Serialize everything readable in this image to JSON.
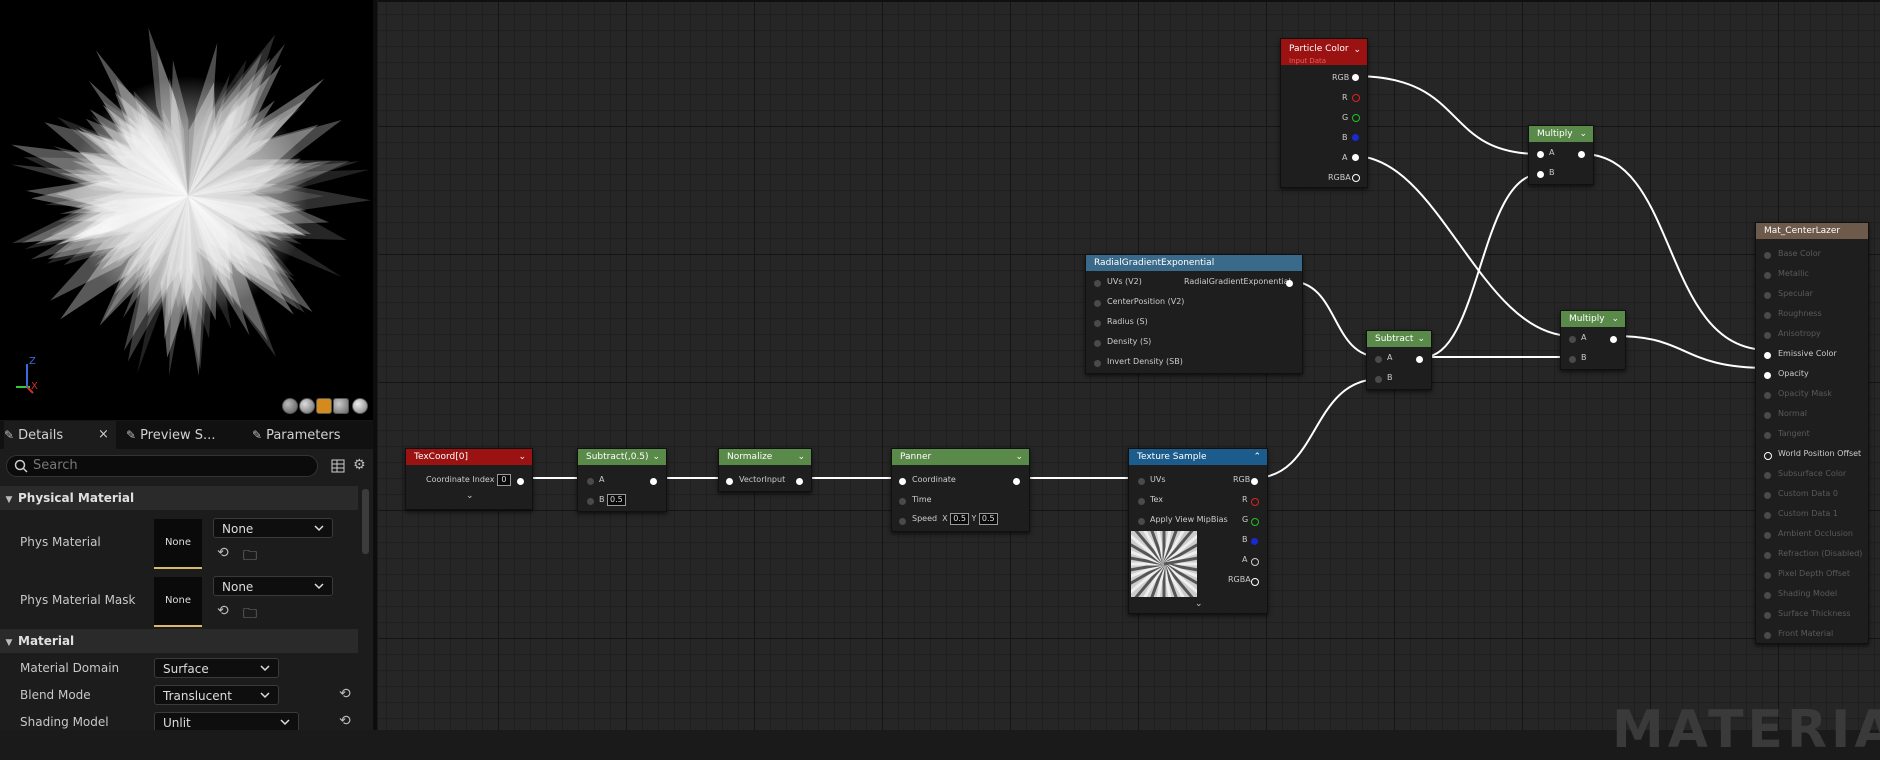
{
  "details_panel": {
    "tabs": [
      {
        "label": "Details",
        "close": "×"
      },
      {
        "label": "Preview S..."
      },
      {
        "label": "Parameters"
      }
    ],
    "search_placeholder": "Search",
    "sections": {
      "physical_material": {
        "title": "Physical Material",
        "phys_material_label": "Phys Material",
        "phys_material_thumb": "None",
        "phys_material_value": "None",
        "phys_material_mask_label": "Phys Material Mask",
        "phys_material_mask_thumb": "None",
        "phys_material_mask_value": "None"
      },
      "material": {
        "title": "Material",
        "material_domain_label": "Material Domain",
        "material_domain_value": "Surface",
        "blend_mode_label": "Blend Mode",
        "blend_mode_value": "Translucent",
        "shading_model_label": "Shading Model",
        "shading_model_value": "Unlit"
      }
    },
    "axis_labels": {
      "z": "Z",
      "x": "X"
    }
  },
  "graph": {
    "watermark": "MATERIAL",
    "nodes": {
      "texcoord": {
        "title": "TexCoord[0]",
        "pins": {
          "coord_index_label": "Coordinate Index",
          "coord_index_value": "0"
        },
        "color": "#9b1212"
      },
      "subtract_const": {
        "title": "Subtract(,0.5)",
        "pins": {
          "a": "A",
          "b": "B",
          "b_value": "0.5"
        },
        "color": "#5a8a4a"
      },
      "normalize": {
        "title": "Normalize",
        "pins": {
          "in": "VectorInput"
        },
        "color": "#5a8a4a"
      },
      "panner": {
        "title": "Panner",
        "pins": {
          "coordinate": "Coordinate",
          "time": "Time",
          "speed": "Speed",
          "speed_x_label": "X",
          "speed_x": "0.5",
          "speed_y_label": "Y",
          "speed_y": "0.5"
        },
        "color": "#5a8a4a"
      },
      "texture_sample": {
        "title": "Texture Sample",
        "pins": {
          "uvs": "UVs",
          "tex": "Tex",
          "apply_mip": "Apply View MipBias",
          "rgb": "RGB",
          "r": "R",
          "g": "G",
          "b": "B",
          "a": "A",
          "rgba": "RGBA"
        },
        "color": "#1c5c8c"
      },
      "radial_gradient": {
        "title": "RadialGradientExponential",
        "pins": {
          "uvs": "UVs (V2)",
          "center": "CenterPosition (V2)",
          "radius": "Radius (S)",
          "density": "Density (S)",
          "invert": "Invert Density (SB)",
          "out": "RadialGradientExponential"
        },
        "color": "#3a6a8a"
      },
      "particle_color": {
        "title": "Particle Color",
        "subtitle": "Input Data",
        "pins": {
          "rgb": "RGB",
          "r": "R",
          "g": "G",
          "b": "B",
          "a": "A",
          "rgba": "RGBA"
        },
        "color": "#9b1212"
      },
      "multiply_top": {
        "title": "Multiply",
        "pins": {
          "a": "A",
          "b": "B"
        },
        "color": "#5a8a4a"
      },
      "subtract": {
        "title": "Subtract",
        "pins": {
          "a": "A",
          "b": "B"
        },
        "color": "#5a8a4a"
      },
      "multiply_mid": {
        "title": "Multiply",
        "pins": {
          "a": "A",
          "b": "B"
        },
        "color": "#5a8a4a"
      },
      "result": {
        "title": "Mat_CenterLazer",
        "color": "#6e5a4a",
        "pins": [
          "Base Color",
          "Metallic",
          "Specular",
          "Roughness",
          "Anisotropy",
          "Emissive Color",
          "Opacity",
          "Opacity Mask",
          "Normal",
          "Tangent",
          "World Position Offset",
          "Subsurface Color",
          "Custom Data 0",
          "Custom Data 1",
          "Ambient Occlusion",
          "Refraction (Disabled)",
          "Pixel Depth Offset",
          "Shading Model",
          "Surface Thickness",
          "Front Material"
        ],
        "active_pins": [
          "Emissive Color",
          "Opacity",
          "World Position Offset"
        ]
      }
    }
  }
}
